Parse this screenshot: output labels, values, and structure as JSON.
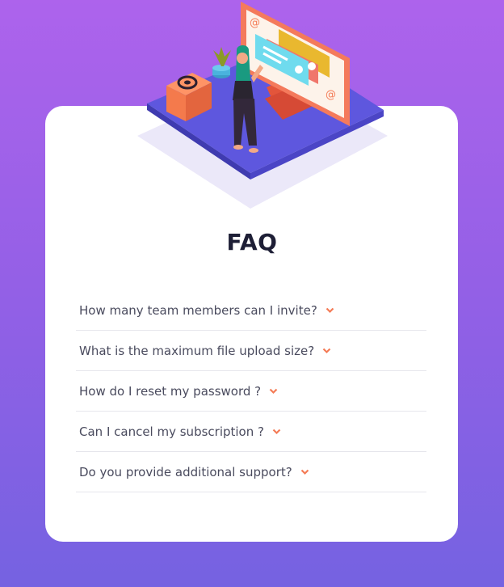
{
  "faq": {
    "title": "FAQ",
    "items": [
      {
        "question": "How many team members can I invite?"
      },
      {
        "question": "What is the maximum file upload size?"
      },
      {
        "question": "How do I reset my password ?"
      },
      {
        "question": "Can I cancel my subscription ?"
      },
      {
        "question": "Do you provide additional support?"
      }
    ]
  },
  "colors": {
    "background_top": "#ad63ec",
    "background_bottom": "#7562e1",
    "card": "#ffffff",
    "title": "#1e1f36",
    "question_text": "#4a4b5e",
    "chevron": "#f47b56",
    "divider": "#e6e6ec"
  },
  "icons": {
    "chevron": "chevron-down-icon",
    "illustration": "woman-online-illustration"
  }
}
